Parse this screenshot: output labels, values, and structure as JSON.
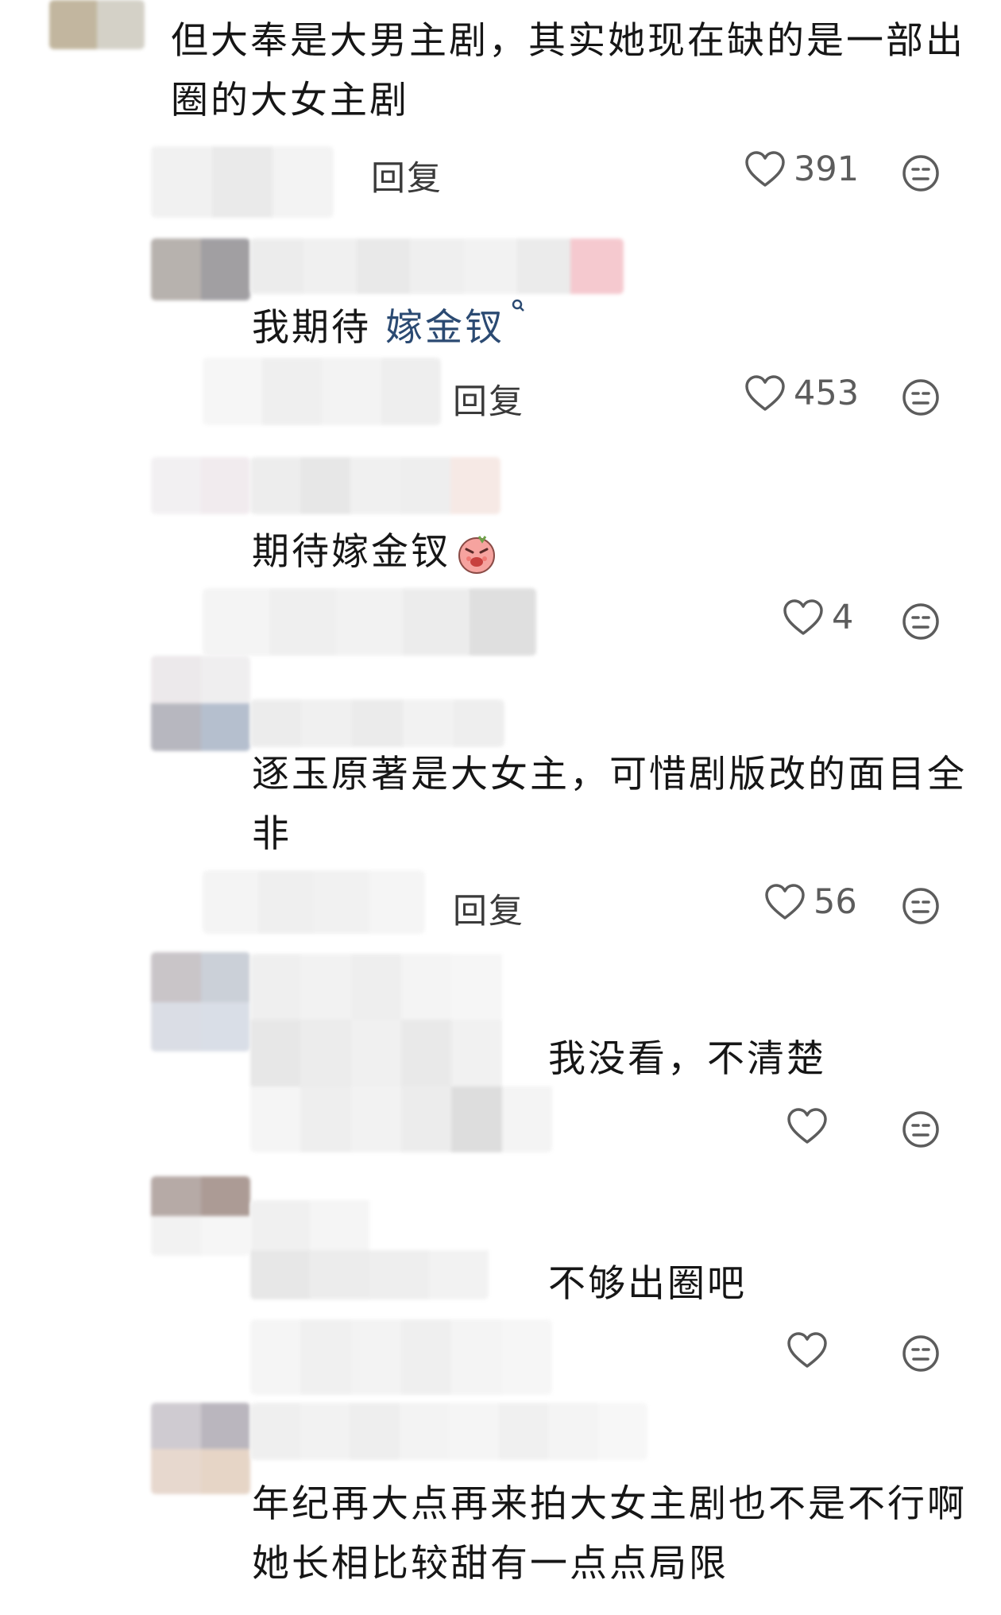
{
  "comments": [
    {
      "text": "但大奉是大男主剧，其实她现在缺的是一部出圈的大女主剧",
      "line1": "但大奉是大男主剧，其实她现在缺的是一部出",
      "line2": "圈的大女主剧",
      "reply_label": "回复",
      "like_count": "391"
    },
    {
      "text_prefix": "我期待 ",
      "link_text": "嫁金钗",
      "reply_label": "回复",
      "like_count": "453"
    },
    {
      "text": "期待嫁金钗",
      "like_count": "4"
    },
    {
      "line1": "逐玉原著是大女主，可惜剧版改的面目全",
      "line2": "非",
      "reply_label": "回复",
      "like_count": "56"
    },
    {
      "text": "我没看，不清楚",
      "like_count": ""
    },
    {
      "text": "不够出圈吧",
      "like_count": ""
    },
    {
      "line1": "年纪再大点再来拍大女主剧也不是不行啊",
      "line2": "她长相比较甜有一点点局限"
    }
  ],
  "icons": {
    "like": "heart-outline-icon",
    "dislike": "meh-face-icon",
    "search": "search-icon",
    "emoji": "angry-cute-sticker-icon"
  },
  "colors": {
    "link": "#2b4a72",
    "text": "#161616",
    "muted": "#5c5c5c"
  }
}
